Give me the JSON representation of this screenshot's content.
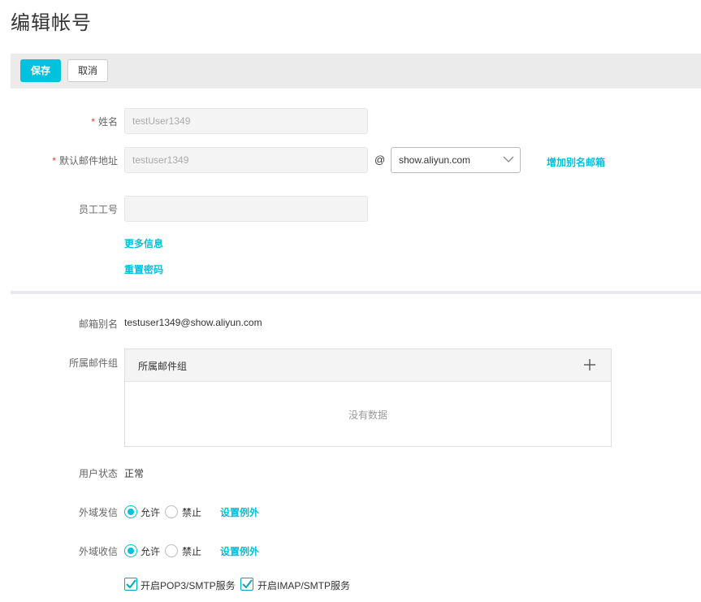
{
  "page": {
    "title": "编辑帐号"
  },
  "toolbar": {
    "save_label": "保存",
    "cancel_label": "取消"
  },
  "form": {
    "name": {
      "label": "姓名",
      "required_mark": "*",
      "value": "testUser1349"
    },
    "default_email": {
      "label": "默认邮件地址",
      "required_mark": "*",
      "value": "testuser1349",
      "at": "@",
      "domain_selected": "show.aliyun.com",
      "add_alias_link": "增加别名邮箱"
    },
    "employee_id": {
      "label": "员工工号",
      "value": ""
    },
    "more_info_link": "更多信息",
    "reset_password_link": "重置密码"
  },
  "details": {
    "alias": {
      "label": "邮箱别名",
      "value": "testuser1349@show.aliyun.com"
    },
    "groups": {
      "label": "所属邮件组",
      "header": "所属邮件组",
      "empty_text": "没有数据",
      "add_icon": "plus-icon"
    },
    "status": {
      "label": "用户状态",
      "value": "正常"
    },
    "outbound": {
      "label": "外域发信",
      "allow": "允许",
      "deny": "禁止",
      "selected": "allow",
      "exception_link": "设置例外"
    },
    "inbound": {
      "label": "外域收信",
      "allow": "允许",
      "deny": "禁止",
      "selected": "allow",
      "exception_link": "设置例外"
    },
    "pop3": {
      "label": "开启POP3/SMTP服务",
      "checked": true
    },
    "imap": {
      "label": "开启IMAP/SMTP服务",
      "checked": true
    }
  },
  "colors": {
    "accent": "#00c1de",
    "required": "#e4393c"
  }
}
